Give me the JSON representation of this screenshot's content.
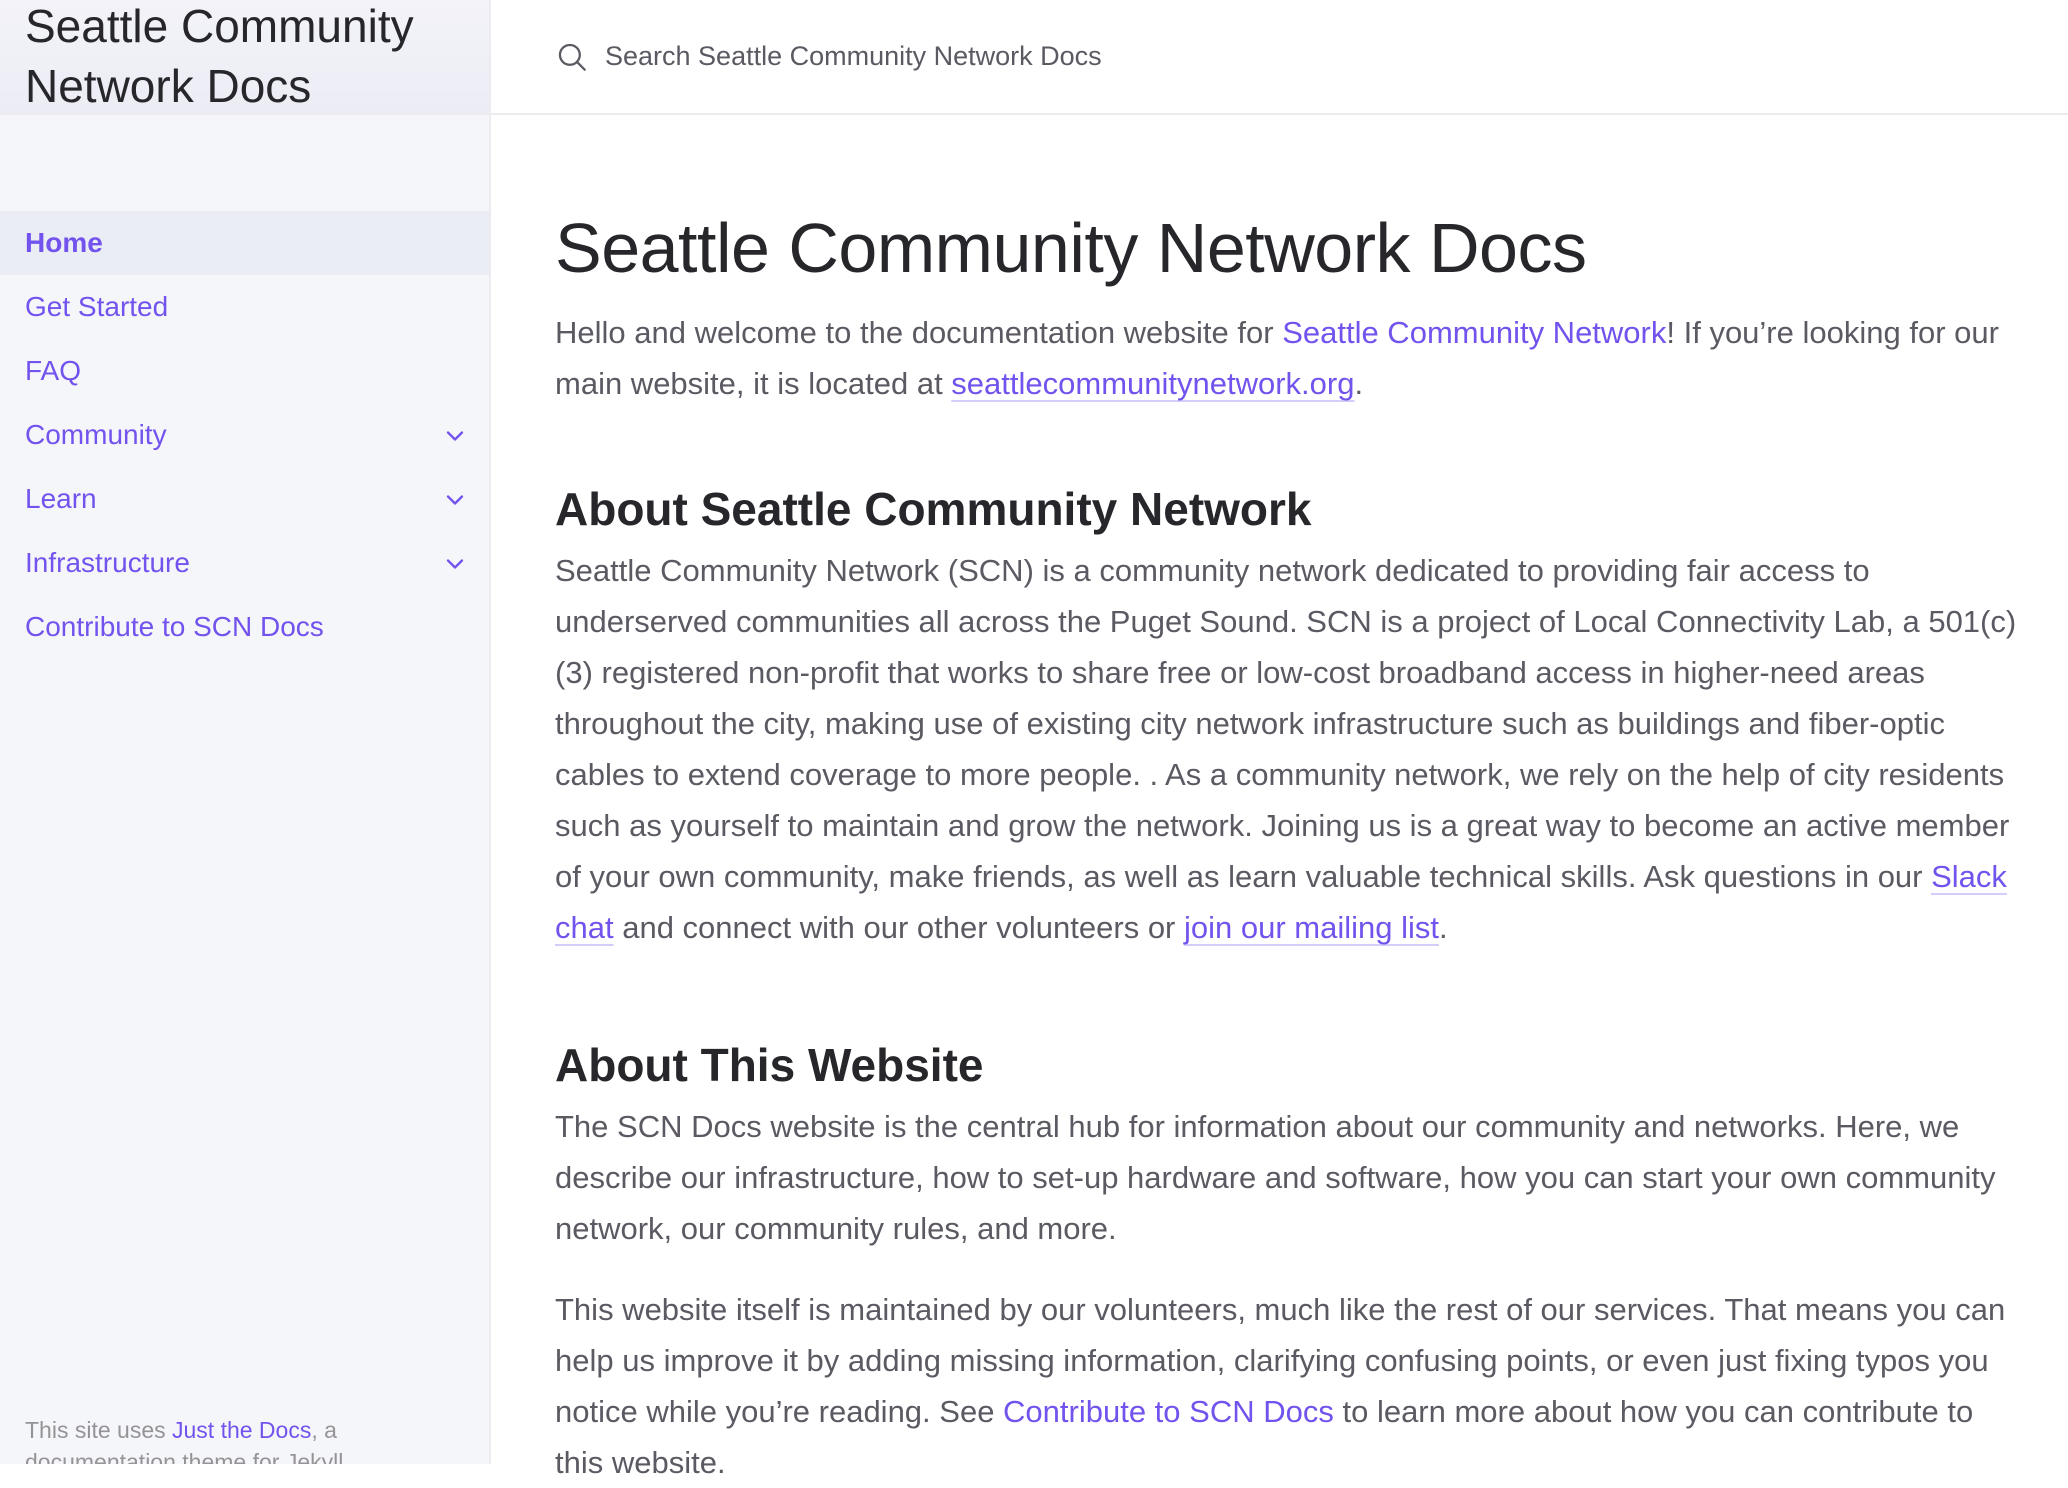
{
  "sidebar": {
    "site_title": "Seattle Community Network Docs",
    "nav": [
      {
        "label": "Home",
        "active": true,
        "expandable": false
      },
      {
        "label": "Get Started",
        "active": false,
        "expandable": false
      },
      {
        "label": "FAQ",
        "active": false,
        "expandable": false
      },
      {
        "label": "Community",
        "active": false,
        "expandable": true
      },
      {
        "label": "Learn",
        "active": false,
        "expandable": true
      },
      {
        "label": "Infrastructure",
        "active": false,
        "expandable": true
      },
      {
        "label": "Contribute to SCN Docs",
        "active": false,
        "expandable": false
      }
    ],
    "footer": {
      "prefix": "This site uses ",
      "link": "Just the Docs",
      "suffix": ", a documentation theme for Jekyll."
    }
  },
  "search": {
    "placeholder": "Search Seattle Community Network Docs",
    "icon": "search-icon"
  },
  "main": {
    "title": "Seattle Community Network Docs",
    "intro": {
      "t1": "Hello and welcome to the documentation website for ",
      "link1": "Seattle Community Network",
      "t2": "! If you’re looking for our main website, it is located at ",
      "link2": "seattlecommunitynetwork.org",
      "t3": "."
    },
    "about_scn": {
      "heading": "About Seattle Community Network",
      "t1": "Seattle Community Network (SCN) is a community network dedicated to providing fair access to underserved communities all across the Puget Sound. SCN is a project of Local Connectivity Lab, a 501(c)(3) registered non-profit that works to share free or low-cost broadband access in higher-need areas throughout the city, making use of existing city network infrastructure such as buildings and fiber-optic cables to extend coverage to more people. . As a community network, we rely on the help of city residents such as yourself to maintain and grow the network. Joining us is a great way to become an active member of your own community, make friends, as well as learn valuable technical skills. Ask questions in our ",
      "link1": "Slack chat",
      "t2": " and connect with our other volunteers or ",
      "link2": "join our mailing list",
      "t3": "."
    },
    "about_site": {
      "heading": "About This Website",
      "p1": "The SCN Docs website is the central hub for information about our community and networks. Here, we describe our infrastructure, how to set-up hardware and software, how you can start your own community network, our community rules, and more.",
      "p2_t1": "This website itself is maintained by our volunteers, much like the rest of our services. That means you can help us improve it by adding missing information, clarifying confusing points, or even just fixing typos you notice while you’re reading. See ",
      "p2_link": "Contribute to SCN Docs",
      "p2_t2": " to learn more about how you can contribute to this website."
    }
  },
  "colors": {
    "link": "#7253ed",
    "heading": "#27262b",
    "body": "#5c5962",
    "sidebar_bg": "#f5f6fa"
  }
}
